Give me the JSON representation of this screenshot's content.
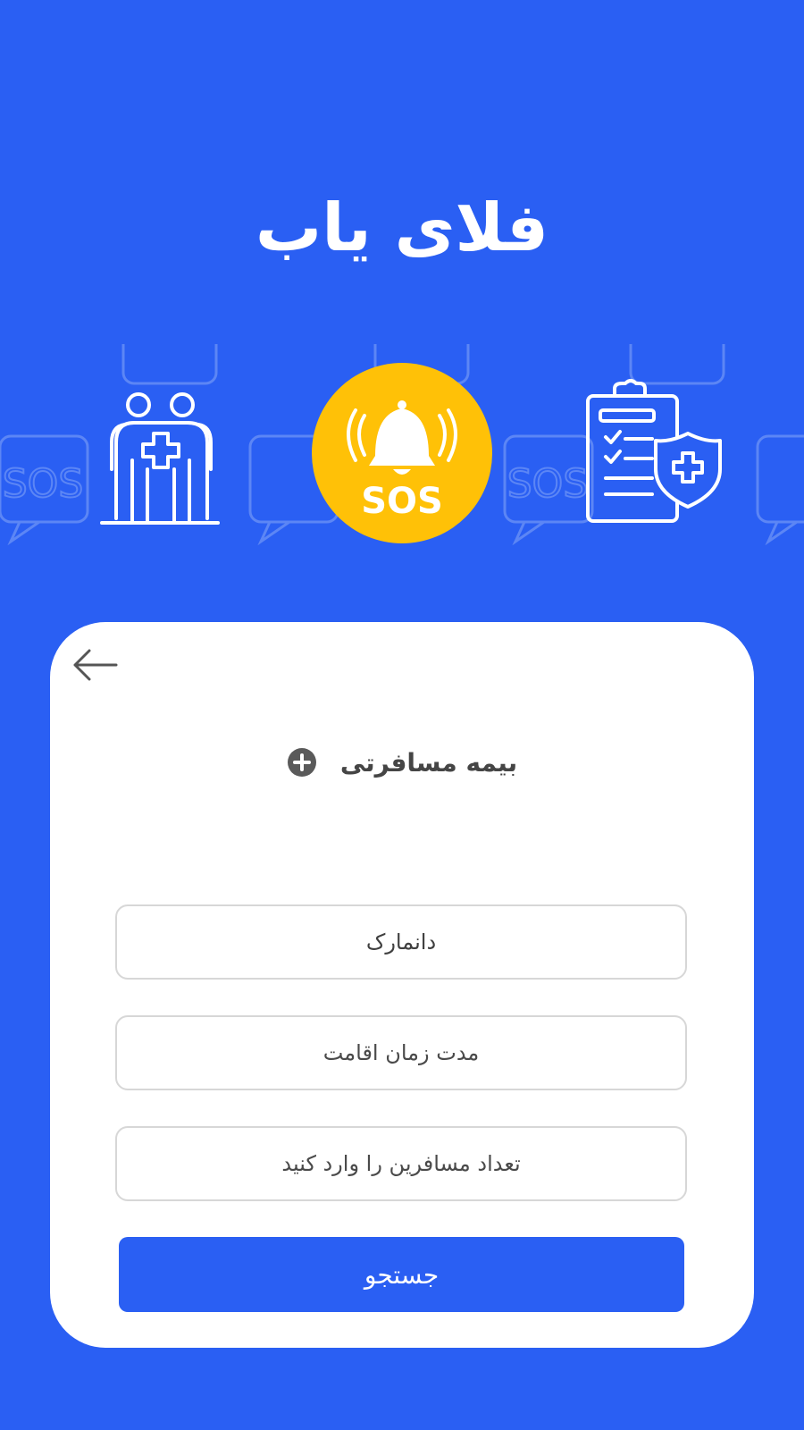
{
  "app": {
    "title": "فلای یاب"
  },
  "hero": {
    "badge_text": "SOS",
    "bubble_text": "SOS",
    "icons": [
      "medical-staff-icon",
      "sos-bell-icon",
      "insurance-clipboard-icon"
    ],
    "colors": {
      "background": "#2a5ff3",
      "badge": "#ffc107",
      "bubble_outline": "#5c86f5"
    }
  },
  "form": {
    "section_title": "بیمه مسافرتی",
    "section_icon": "plus-circle-icon",
    "destination_value": "دانمارک",
    "duration_placeholder": "مدت زمان اقامت",
    "travelers_placeholder": "تعداد مسافرین را وارد کنید",
    "search_label": "جستجو",
    "back_icon": "arrow-left-icon",
    "colors": {
      "primary": "#2a5ff3",
      "border": "#d7d7d7",
      "text": "#454545"
    }
  }
}
